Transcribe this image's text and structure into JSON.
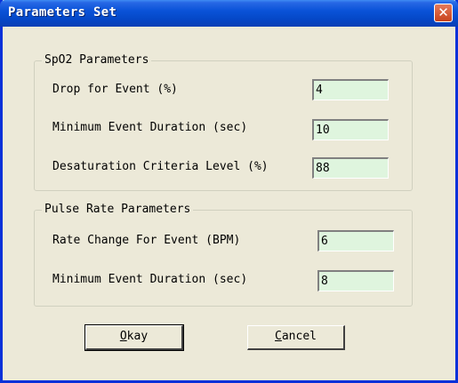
{
  "window": {
    "title": "Parameters Set",
    "close_glyph": "✕"
  },
  "spo2_group": {
    "title": "SpO2 Parameters",
    "rows": [
      {
        "label": "Drop for Event (%)",
        "value": "4"
      },
      {
        "label": "Minimum Event Duration (sec)",
        "value": "10"
      },
      {
        "label": "Desaturation Criteria Level (%)",
        "value": "88"
      }
    ]
  },
  "pulse_group": {
    "title": "Pulse Rate Parameters",
    "rows": [
      {
        "label": "Rate Change For Event (BPM)",
        "value": "6"
      },
      {
        "label": "Minimum Event Duration (sec)",
        "value": "8"
      }
    ]
  },
  "buttons": {
    "okay": {
      "mnemonic": "O",
      "rest": "kay"
    },
    "cancel": {
      "mnemonic": "C",
      "rest": "ancel"
    }
  },
  "colors": {
    "field_bg": "#dff5de",
    "titlebar": "#0a53d8",
    "dialog_bg": "#ece9d8"
  }
}
